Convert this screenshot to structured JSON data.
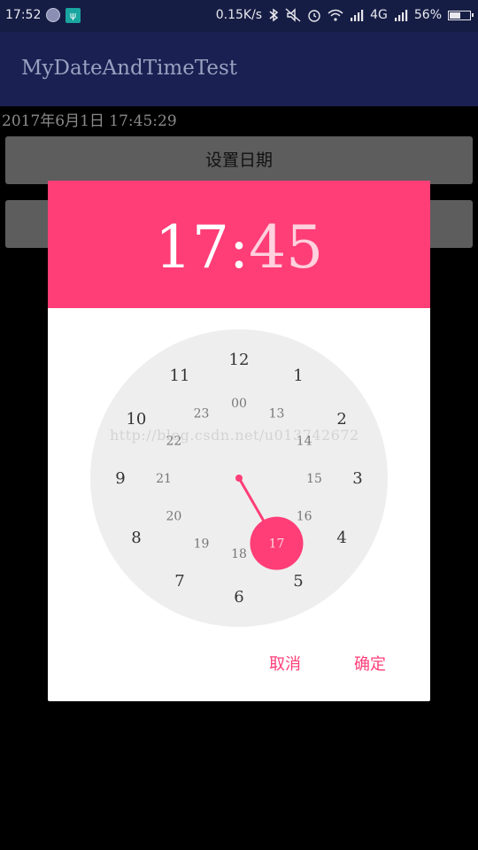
{
  "status_bar": {
    "time": "17:52",
    "network_speed": "0.15K/s",
    "network_type": "4G",
    "battery_percent": "56%",
    "battery_level": 0.56,
    "usb_icon": "ψ"
  },
  "action_bar": {
    "title": "MyDateAndTimeTest"
  },
  "content": {
    "datetime_text": "2017年6月1日  17:45:29",
    "set_date_button": "设置日期"
  },
  "dialog": {
    "hour": "17",
    "colon": ":",
    "minute": "45",
    "outer_numbers": [
      "12",
      "1",
      "2",
      "3",
      "4",
      "5",
      "6",
      "7",
      "8",
      "9",
      "10",
      "11"
    ],
    "inner_numbers": [
      "00",
      "13",
      "14",
      "15",
      "16",
      "17",
      "18",
      "19",
      "20",
      "21",
      "22",
      "23"
    ],
    "selected_inner_index": 5,
    "cancel_label": "取消",
    "ok_label": "确定",
    "watermark": "http://blog.csdn.net/u013742672",
    "colors": {
      "accent": "#ff3d77",
      "clock_face": "#eeeeee"
    }
  }
}
